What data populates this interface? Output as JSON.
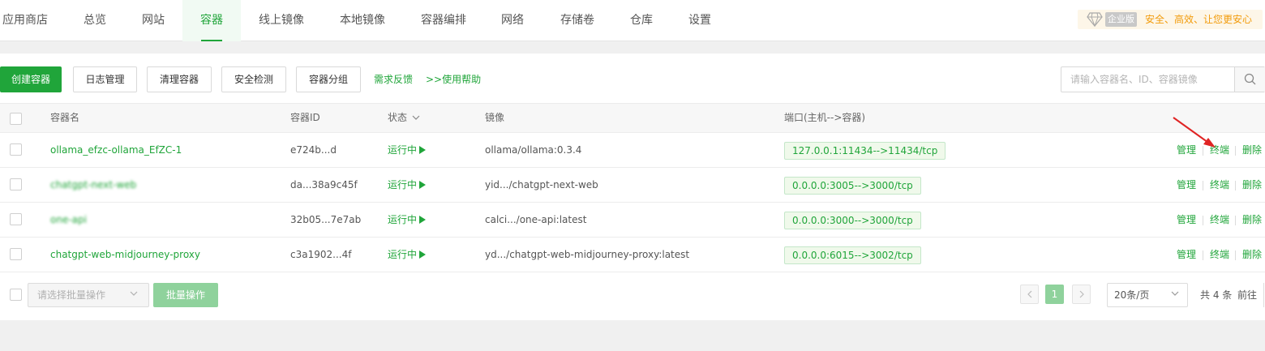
{
  "nav": {
    "tabs": [
      "应用商店",
      "总览",
      "网站",
      "容器",
      "线上镜像",
      "本地镜像",
      "容器编排",
      "网络",
      "存储卷",
      "仓库",
      "设置"
    ],
    "active": "容器",
    "enterprise_badge": "企业版",
    "enterprise_slogan": "安全、高效、让您更安心"
  },
  "toolbar": {
    "create": "创建容器",
    "log": "日志管理",
    "clean": "清理容器",
    "security": "安全检测",
    "group": "容器分组",
    "feedback": "需求反馈",
    "help": ">>使用帮助",
    "search_placeholder": "请输入容器名、ID、容器镜像"
  },
  "table": {
    "headers": {
      "name": "容器名",
      "id": "容器ID",
      "status": "状态",
      "image": "镜像",
      "ports": "端口(主机-->容器)"
    },
    "actions": [
      "管理",
      "终端",
      "删除"
    ],
    "rows": [
      {
        "name": "ollama_efzc-ollama_EfZC-1",
        "id": "e724b...d",
        "status": "运行中",
        "image": "ollama/ollama:0.3.4",
        "ports": "127.0.0.1:11434-->11434/tcp"
      },
      {
        "name": "chatgpt-next-web",
        "id": "da...38a9c45f",
        "status": "运行中",
        "image": "yid.../chatgpt-next-web",
        "ports": "0.0.0.0:3005-->3000/tcp"
      },
      {
        "name": "one-api",
        "id": "32b05...7e7ab",
        "status": "运行中",
        "image": "calci.../one-api:latest",
        "ports": "0.0.0.0:3000-->3000/tcp"
      },
      {
        "name": "chatgpt-web-midjourney-proxy",
        "id": "c3a1902...4f",
        "status": "运行中",
        "image": "yd.../chatgpt-web-midjourney-proxy:latest",
        "ports": "0.0.0.0:6015-->3002/tcp"
      }
    ]
  },
  "footer": {
    "batch_placeholder": "请选择批量操作",
    "batch_button": "批量操作",
    "current_page": "1",
    "page_size": "20条/页",
    "total": "共 4 条",
    "goto": "前往"
  },
  "colors": {
    "accent": "#20a53a",
    "annotation_arrow": "#e02424"
  }
}
